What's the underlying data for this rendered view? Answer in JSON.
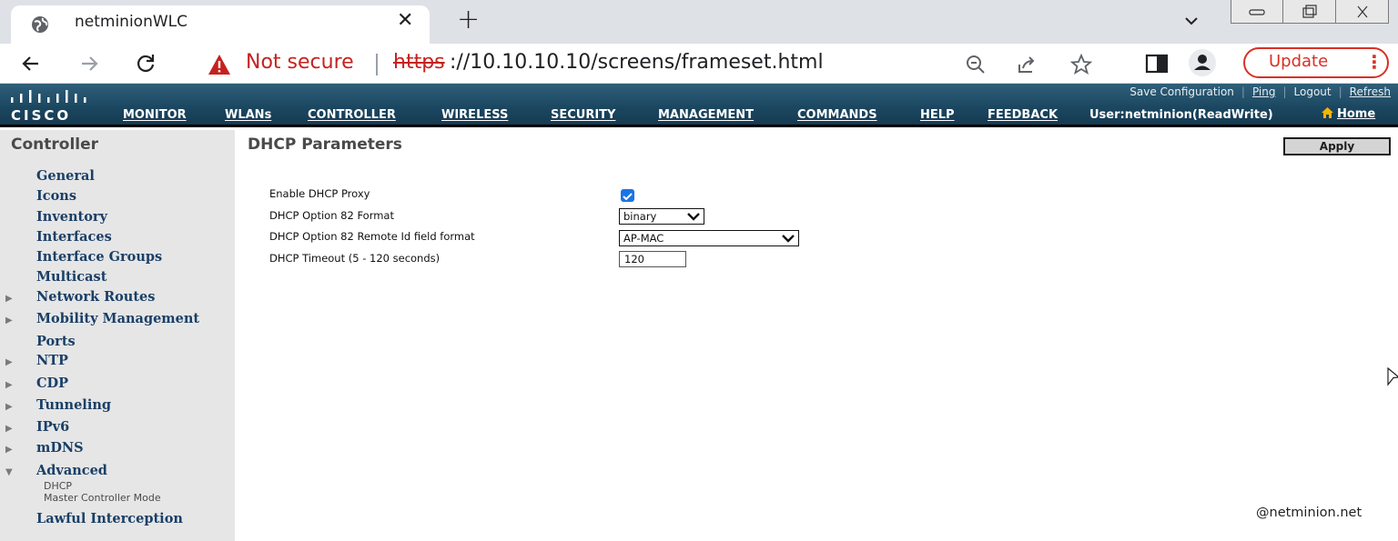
{
  "browser": {
    "tab_title": "netminionWLC",
    "security_label": "Not secure",
    "url_scheme": "https",
    "url_rest": "://10.10.10.10/screens/frameset.html",
    "update_label": "Update"
  },
  "header": {
    "logo_text": "CISCO",
    "top_links": [
      "Save Configuration",
      "Ping",
      "Logout",
      "Refresh"
    ],
    "menu": [
      "MONITOR",
      "WLANs",
      "CONTROLLER",
      "WIRELESS",
      "SECURITY",
      "MANAGEMENT",
      "COMMANDS",
      "HELP",
      "FEEDBACK"
    ],
    "active_menu": "CONTROLLER",
    "user_info": "User:netminion(ReadWrite)",
    "home_label": "Home"
  },
  "sidebar": {
    "title": "Controller",
    "items": [
      {
        "label": "General",
        "expandable": false
      },
      {
        "label": "Icons",
        "expandable": false
      },
      {
        "label": "Inventory",
        "expandable": false
      },
      {
        "label": "Interfaces",
        "expandable": false
      },
      {
        "label": "Interface Groups",
        "expandable": false
      },
      {
        "label": "Multicast",
        "expandable": false
      },
      {
        "label": "Network Routes",
        "expandable": true
      },
      {
        "label": "Mobility Management",
        "expandable": true
      },
      {
        "label": "Ports",
        "expandable": false
      },
      {
        "label": "NTP",
        "expandable": true
      },
      {
        "label": "CDP",
        "expandable": true
      },
      {
        "label": "Tunneling",
        "expandable": true
      },
      {
        "label": "IPv6",
        "expandable": true
      },
      {
        "label": "mDNS",
        "expandable": true
      },
      {
        "label": "Advanced",
        "expandable": true,
        "expanded": true
      },
      {
        "label": "Lawful Interception",
        "expandable": false
      }
    ],
    "advanced_children": [
      "DHCP",
      "Master Controller Mode"
    ]
  },
  "main": {
    "title": "DHCP Parameters",
    "apply_label": "Apply",
    "fields": [
      {
        "label": "Enable DHCP Proxy"
      },
      {
        "label": "DHCP Option 82 Format"
      },
      {
        "label": "DHCP Option 82 Remote Id field format"
      },
      {
        "label": "DHCP Timeout (5 - 120 seconds)"
      }
    ],
    "dhcp_proxy_enabled": true,
    "option82_format": "binary",
    "remote_id_format": "AP-MAC",
    "timeout_value": "120"
  },
  "watermark": "@netminion.net",
  "colors": {
    "header_bg": "#1b4660",
    "sidebar_bg": "#e6e6e6",
    "nav_link": "#1a3f67",
    "security_warning": "#c5221f"
  }
}
